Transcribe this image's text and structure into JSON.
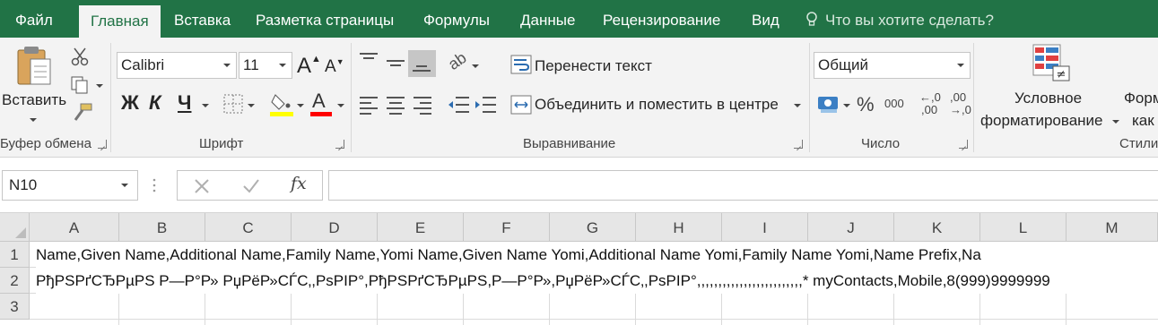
{
  "tabs": [
    {
      "label": "Файл"
    },
    {
      "label": "Главная"
    },
    {
      "label": "Вставка"
    },
    {
      "label": "Разметка страницы"
    },
    {
      "label": "Формулы"
    },
    {
      "label": "Данные"
    },
    {
      "label": "Рецензирование"
    },
    {
      "label": "Вид"
    }
  ],
  "tell_me": "Что вы хотите сделать?",
  "clipboard": {
    "paste_label": "Вставить",
    "group_label": "Буфер обмена"
  },
  "font": {
    "name": "Calibri",
    "size": "11",
    "bold": "Ж",
    "italic": "К",
    "underline": "Ч",
    "group_label": "Шрифт"
  },
  "alignment": {
    "wrap_text": "Перенести текст",
    "merge_center": "Объединить и поместить в центре",
    "group_label": "Выравнивание"
  },
  "number": {
    "format": "Общий",
    "percent": "%",
    "thousands": "000",
    "inc_decimal_top": "←,0",
    "inc_decimal_bottom": ",00",
    "dec_decimal_top": ",00",
    "dec_decimal_bottom": "→,0",
    "group_label": "Число"
  },
  "styles": {
    "cond_format_line1": "Условное",
    "cond_format_line2": "форматирование",
    "format_table_line1": "Форм",
    "format_table_line2": "как",
    "group_label": "Стили"
  },
  "formula_bar": {
    "name_box": "N10",
    "fx": "fx",
    "value": ""
  },
  "columns": [
    "A",
    "B",
    "C",
    "D",
    "E",
    "F",
    "G",
    "H",
    "I",
    "J",
    "K",
    "L",
    "M"
  ],
  "rows": [
    {
      "num": "1",
      "text": "Name,Given Name,Additional Name,Family Name,Yomi Name,Given Name Yomi,Additional Name Yomi,Family Name Yomi,Name Prefix,Na"
    },
    {
      "num": "2",
      "text": "РђРЅРґСЂРµРЅ Р—Р°Р» РџРёР»СЃС‚,РѕРІР°,РђРЅРґСЂРµРЅ,Р—Р°Р»,РџРёР»СЃС‚,РѕРІР°,,,,,,,,,,,,,,,,,,,,,,,,,* myContacts,Mobile,8(999)9999999"
    },
    {
      "num": "3",
      "text": ""
    }
  ],
  "colors": {
    "accent": "#217346",
    "ribbon_bg": "#f3f3f3",
    "header_bg": "#e6e6e6"
  }
}
